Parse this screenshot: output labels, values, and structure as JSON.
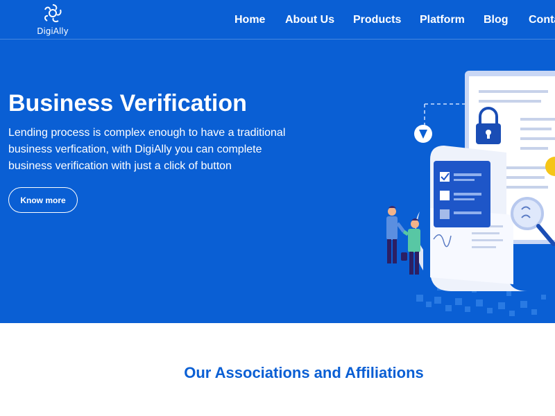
{
  "brand": {
    "name": "DigiAlly"
  },
  "nav": {
    "items": [
      "Home",
      "About Us",
      "Products",
      "Platform",
      "Blog",
      "Conta"
    ]
  },
  "hero": {
    "title": "Business Verification",
    "lines": [
      "Lending process is complex enough to have a traditional",
      "business verfication, with DigiAlly you can complete",
      "business verification with just a click of button"
    ],
    "cta_label": "Know more"
  },
  "section": {
    "title": "Our Associations and Affiliations"
  },
  "colors": {
    "primary": "#0a5fd4",
    "white": "#ffffff"
  }
}
